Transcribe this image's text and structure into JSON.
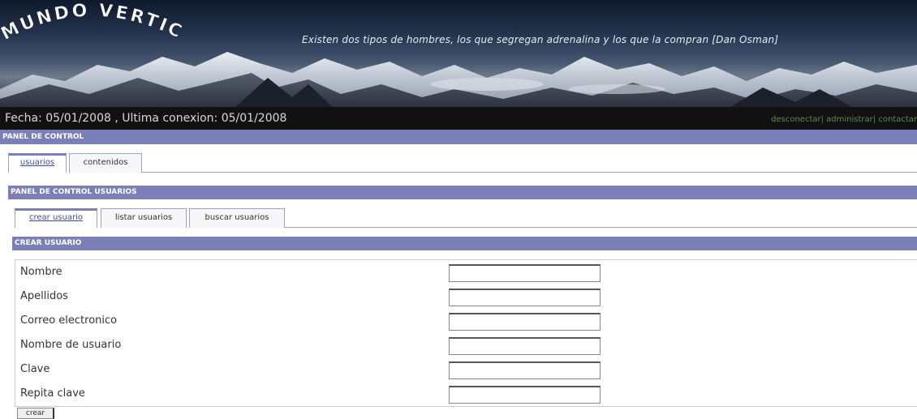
{
  "header": {
    "logo": "MUNDO VERTICAL",
    "quote": "Existen dos tipos de hombres, los que segregan adrenalina y los que la compran [Dan Osman]"
  },
  "infobar": {
    "date_text": "Fecha: 05/01/2008 , Ultima conexion: 05/01/2008",
    "links": [
      "desconectar",
      "administrar",
      "contactar"
    ],
    "separator": "|"
  },
  "panel": {
    "title": "PANEL DE CONTROL",
    "tabs": [
      "usuarios",
      "contenidos"
    ],
    "users_title": "PANEL DE CONTROL USUARIOS",
    "sub_tabs": [
      "crear usuario",
      "listar usuarios",
      "buscar usuarios"
    ],
    "create_title": "CREAR USUARIO"
  },
  "form": {
    "fields": [
      {
        "label": "Nombre",
        "value": ""
      },
      {
        "label": "Apellidos",
        "value": ""
      },
      {
        "label": "Correo electronico",
        "value": ""
      },
      {
        "label": "Nombre de usuario",
        "value": ""
      },
      {
        "label": "Clave",
        "value": ""
      },
      {
        "label": "Repita clave",
        "value": ""
      }
    ],
    "submit_label": "crear"
  },
  "colors": {
    "bar": "#7a7fb8",
    "link_green": "#5f8b4a",
    "infobar": "#111111"
  }
}
